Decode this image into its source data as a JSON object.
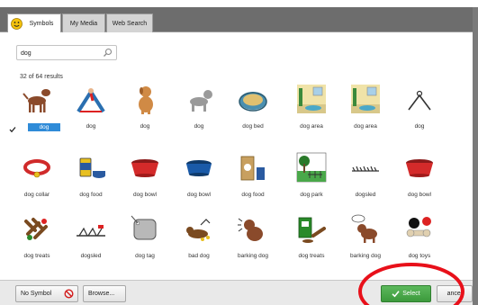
{
  "tabs": [
    {
      "label": "Symbols",
      "active": true
    },
    {
      "label": "My Media",
      "active": false
    },
    {
      "label": "Web Search",
      "active": false
    }
  ],
  "search": {
    "value": "dog"
  },
  "results": {
    "count_text": "32 of 64 results"
  },
  "symbols": [
    {
      "label": "dog",
      "icon": "dog-standing",
      "selected": true
    },
    {
      "label": "dog",
      "icon": "dog-yoga-pose"
    },
    {
      "label": "dog",
      "icon": "dog-sitting"
    },
    {
      "label": "dog",
      "icon": "dog-gray"
    },
    {
      "label": "dog bed",
      "icon": "dog-bed"
    },
    {
      "label": "dog area",
      "icon": "dog-area-room"
    },
    {
      "label": "dog area",
      "icon": "dog-area-room"
    },
    {
      "label": "dog",
      "icon": "dog-yoga-outline"
    },
    {
      "label": "dog collar",
      "icon": "dog-collar"
    },
    {
      "label": "dog food",
      "icon": "dog-food-can"
    },
    {
      "label": "dog bowl",
      "icon": "dog-bowl-red"
    },
    {
      "label": "dog bowl",
      "icon": "dog-bowl-blue"
    },
    {
      "label": "dog food",
      "icon": "dog-food-bag"
    },
    {
      "label": "dog park",
      "icon": "dog-park"
    },
    {
      "label": "dogsled",
      "icon": "dogsled-outline"
    },
    {
      "label": "dog bowl",
      "icon": "dog-bowl-red"
    },
    {
      "label": "dog treats",
      "icon": "dog-treats"
    },
    {
      "label": "dogsled",
      "icon": "dogsled-team"
    },
    {
      "label": "dog tag",
      "icon": "dog-tag"
    },
    {
      "label": "bad dog",
      "icon": "bad-dog"
    },
    {
      "label": "barking dog",
      "icon": "barking-dog"
    },
    {
      "label": "dog treats",
      "icon": "dog-treats-box"
    },
    {
      "label": "barking dog",
      "icon": "barking-dog-speech"
    },
    {
      "label": "dog toys",
      "icon": "dog-toys"
    }
  ],
  "buttons": {
    "no_symbol": "No Symbol",
    "browse": "Browse...",
    "select": "Select",
    "cancel": "ancel"
  },
  "colors": {
    "tab_bar": "#6d6d6d",
    "selection": "#2f8bd8",
    "select_button": "#4cae4c",
    "annotation": "#e8101a"
  }
}
